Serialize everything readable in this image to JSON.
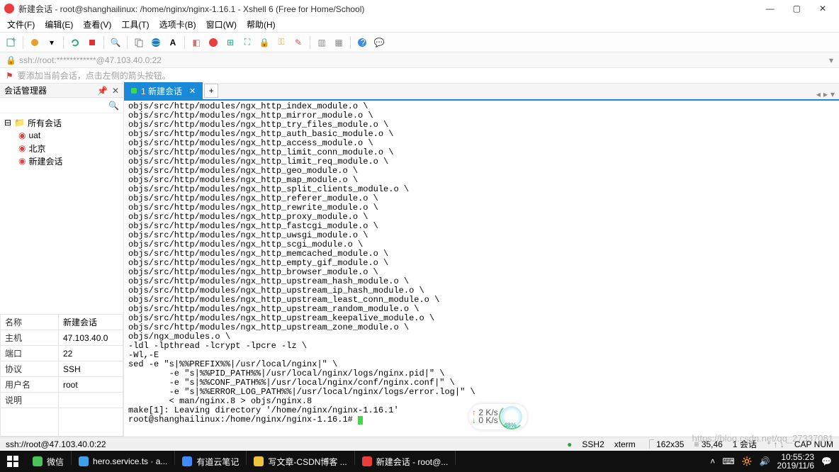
{
  "title": "新建会话 - root@shanghailinux: /home/nginx/nginx-1.16.1 - Xshell 6 (Free for Home/School)",
  "menu": [
    "文件(F)",
    "编辑(E)",
    "查看(V)",
    "工具(T)",
    "选项卡(B)",
    "窗口(W)",
    "帮助(H)"
  ],
  "address": "ssh://root:************@47.103.40.0:22",
  "tip": "要添加当前会话，点击左侧的箭头按钮。",
  "sidebar": {
    "title": "会话管理器",
    "root": "所有会话",
    "items": [
      "uat",
      "北京",
      "新建会话"
    ]
  },
  "props": [
    [
      "名称",
      "新建会话"
    ],
    [
      "主机",
      "47.103.40.0"
    ],
    [
      "端口",
      "22"
    ],
    [
      "协议",
      "SSH"
    ],
    [
      "用户名",
      "root"
    ],
    [
      "说明",
      ""
    ]
  ],
  "tab": {
    "label": "1 新建会话"
  },
  "terminal_lines": [
    "objs/src/http/modules/ngx_http_index_module.o \\",
    "objs/src/http/modules/ngx_http_mirror_module.o \\",
    "objs/src/http/modules/ngx_http_try_files_module.o \\",
    "objs/src/http/modules/ngx_http_auth_basic_module.o \\",
    "objs/src/http/modules/ngx_http_access_module.o \\",
    "objs/src/http/modules/ngx_http_limit_conn_module.o \\",
    "objs/src/http/modules/ngx_http_limit_req_module.o \\",
    "objs/src/http/modules/ngx_http_geo_module.o \\",
    "objs/src/http/modules/ngx_http_map_module.o \\",
    "objs/src/http/modules/ngx_http_split_clients_module.o \\",
    "objs/src/http/modules/ngx_http_referer_module.o \\",
    "objs/src/http/modules/ngx_http_rewrite_module.o \\",
    "objs/src/http/modules/ngx_http_proxy_module.o \\",
    "objs/src/http/modules/ngx_http_fastcgi_module.o \\",
    "objs/src/http/modules/ngx_http_uwsgi_module.o \\",
    "objs/src/http/modules/ngx_http_scgi_module.o \\",
    "objs/src/http/modules/ngx_http_memcached_module.o \\",
    "objs/src/http/modules/ngx_http_empty_gif_module.o \\",
    "objs/src/http/modules/ngx_http_browser_module.o \\",
    "objs/src/http/modules/ngx_http_upstream_hash_module.o \\",
    "objs/src/http/modules/ngx_http_upstream_ip_hash_module.o \\",
    "objs/src/http/modules/ngx_http_upstream_least_conn_module.o \\",
    "objs/src/http/modules/ngx_http_upstream_random_module.o \\",
    "objs/src/http/modules/ngx_http_upstream_keepalive_module.o \\",
    "objs/src/http/modules/ngx_http_upstream_zone_module.o \\",
    "objs/ngx_modules.o \\",
    "-ldl -lpthread -lcrypt -lpcre -lz \\",
    "-Wl,-E",
    "sed -e \"s|%%PREFIX%%|/usr/local/nginx|\" \\",
    "        -e \"s|%%PID_PATH%%|/usr/local/nginx/logs/nginx.pid|\" \\",
    "        -e \"s|%%CONF_PATH%%|/usr/local/nginx/conf/nginx.conf|\" \\",
    "        -e \"s|%%ERROR_LOG_PATH%%|/usr/local/nginx/logs/error.log|\" \\",
    "        < man/nginx.8 > objs/nginx.8",
    "make[1]: Leaving directory '/home/nginx/nginx-1.16.1'"
  ],
  "prompt": "root@shanghailinux:/home/nginx/nginx-1.16.1# ",
  "widget": {
    "up": "2  K/s",
    "down": "0  K/s",
    "pct": "48%"
  },
  "status": {
    "left": "ssh://root@47.103.40.0:22",
    "ssh": "SSH2",
    "term": "xterm",
    "size": "162x35",
    "pos": "35,46",
    "sess": "1 会话",
    "cap": "CAP  NUM"
  },
  "taskbar": {
    "items": [
      {
        "icon": "wechat",
        "label": "微信",
        "color": "#49c35a"
      },
      {
        "icon": "vscode",
        "label": "hero.service.ts · a...",
        "color": "#3ea0e8"
      },
      {
        "icon": "note",
        "label": "有道云笔记",
        "color": "#3f8cff"
      },
      {
        "icon": "chrome",
        "label": "写文章-CSDN博客 ...",
        "color": "#efc23c"
      },
      {
        "icon": "xshell",
        "label": "新建会话 - root@...",
        "color": "#e93e3e"
      }
    ],
    "time": "10:55:23",
    "date": "2019/11/6"
  },
  "watermark": "https://blog.csdn.net/qq_27337081"
}
